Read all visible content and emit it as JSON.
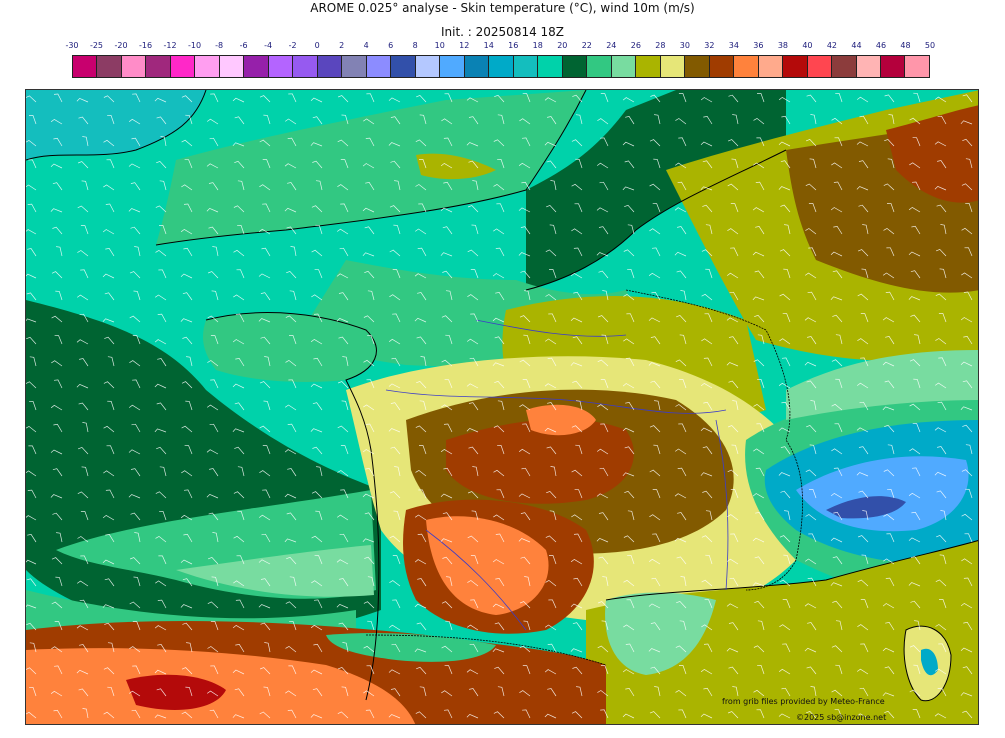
{
  "header": {
    "title": "AROME 0.025° analyse - Skin temperature (°C), wind 10m (m/s)",
    "subtitle": "Init. : 20250814 18Z"
  },
  "legend": {
    "labels": [
      "-30",
      "-25",
      "-20",
      "-16",
      "-12",
      "-10",
      "-8",
      "-6",
      "-4",
      "-2",
      "0",
      "2",
      "4",
      "6",
      "8",
      "10",
      "12",
      "14",
      "16",
      "18",
      "20",
      "22",
      "24",
      "26",
      "28",
      "30",
      "32",
      "34",
      "36",
      "38",
      "40",
      "42",
      "44",
      "46",
      "48",
      "50"
    ],
    "colors": [
      "#c8006e",
      "#8c3c64",
      "#ff8cc8",
      "#a0287d",
      "#ff28c8",
      "#ff9ef0",
      "#ffc8ff",
      "#9620aa",
      "#b464ff",
      "#965af0",
      "#5a46be",
      "#8282b4",
      "#8c8cff",
      "#3250aa",
      "#b4c8ff",
      "#50aaff",
      "#0a82b4",
      "#00aac8",
      "#14bebe",
      "#00d2aa",
      "#006432",
      "#32c882",
      "#78dca0",
      "#aab400",
      "#e6e678",
      "#825a00",
      "#a03c00",
      "#ff823c",
      "#ffaa8c",
      "#b40a0a",
      "#ff4650",
      "#8c3c3c",
      "#ffb4b4",
      "#b4003c",
      "#ff96aa"
    ]
  },
  "map": {
    "wind_barb_color": "#ffffff",
    "coast_color": "#000000",
    "river_color": "#3c3cc8"
  },
  "credits": {
    "source": "from grib files provided by Meteo-France",
    "copyright": "©2025 sb@inzone.net"
  }
}
